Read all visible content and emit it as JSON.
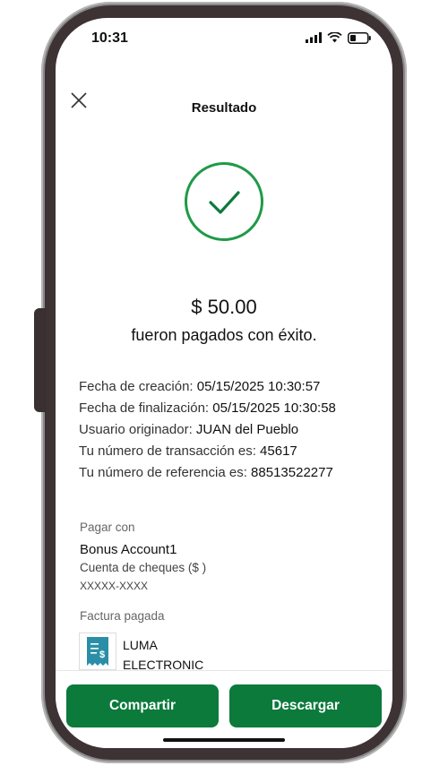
{
  "status_bar": {
    "time": "10:31"
  },
  "header": {
    "title": "Resultado"
  },
  "result": {
    "amount": "$ 50.00",
    "message": "fueron pagados con éxito."
  },
  "details": [
    {
      "label": "Fecha de creación: ",
      "value": "05/15/2025 10:30:57"
    },
    {
      "label": "Fecha de finalización: ",
      "value": "05/15/2025 10:30:58"
    },
    {
      "label": "Usuario originador: ",
      "value": "JUAN del Pueblo"
    },
    {
      "label": "Tu número de transacción es: ",
      "value": "45617"
    },
    {
      "label": "Tu número de referencia es: ",
      "value": "88513522277"
    }
  ],
  "pay_with": {
    "label": "Pagar con",
    "account_name": "Bonus Account1",
    "account_type": "Cuenta de cheques ($ )",
    "account_mask": "XXXXX-XXXX"
  },
  "bill": {
    "label": "Factura pagada",
    "name_line1": "LUMA",
    "name_line2": "ELECTRONIC"
  },
  "actions": {
    "share_label": "Compartir",
    "download_label": "Descargar"
  },
  "colors": {
    "primary": "#0b7a3b",
    "success_ring": "#1e9a48"
  }
}
